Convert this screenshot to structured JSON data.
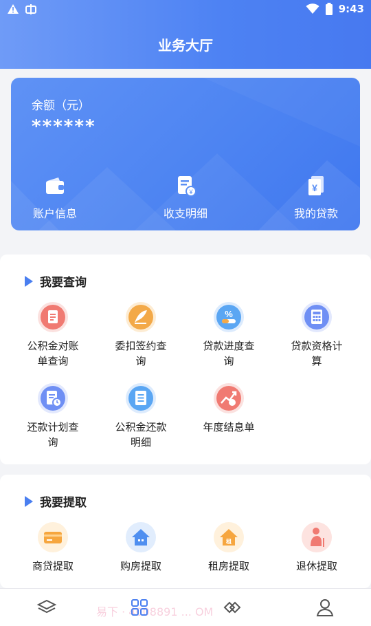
{
  "status_bar": {
    "time": "9:43"
  },
  "header": {
    "title": "业务大厅"
  },
  "balance_card": {
    "label": "余额（元）",
    "value": "******",
    "actions": [
      {
        "label": "账户信息",
        "icon": "wallet-icon"
      },
      {
        "label": "收支明细",
        "icon": "receipt-icon"
      },
      {
        "label": "我的贷款",
        "icon": "loan-icon"
      }
    ]
  },
  "query_section": {
    "title": "我要查询",
    "items": [
      {
        "line1": "公积金对账",
        "line2": "单查询",
        "icon": "statement-icon",
        "color": "#f07a72"
      },
      {
        "line1": "委扣签约查",
        "line2": "询",
        "icon": "signature-icon",
        "color": "#f3a948"
      },
      {
        "line1": "贷款进度查",
        "line2": "询",
        "icon": "percent-icon",
        "color": "#5aa6f3"
      },
      {
        "line1": "贷款资格计",
        "line2": "算",
        "icon": "calculator-icon",
        "color": "#6f8ff4"
      },
      {
        "line1": "还款计划查",
        "line2": "询",
        "icon": "plan-icon",
        "color": "#6f8ff4"
      },
      {
        "line1": "公积金还款",
        "line2": "明细",
        "icon": "list-icon",
        "color": "#5aa6f3"
      },
      {
        "line1": "年度结息单",
        "line2": "",
        "icon": "interest-icon",
        "color": "#f07a72"
      }
    ]
  },
  "withdraw_section": {
    "title": "我要提取",
    "items": [
      {
        "label": "商贷提取",
        "icon": "card-icon",
        "color": "#f6a63f"
      },
      {
        "label": "购房提取",
        "icon": "house-icon",
        "color": "#4f8ff0"
      },
      {
        "label": "租房提取",
        "icon": "rent-house-icon",
        "color": "#f6a63f"
      },
      {
        "label": "退休提取",
        "icon": "retire-icon",
        "color": "#f07a72"
      }
    ]
  },
  "bottom_nav": {
    "items": [
      "layers-icon",
      "grid-icon",
      "handshake-icon",
      "user-icon"
    ],
    "watermark": "易下 · 4008891 ... OM"
  }
}
